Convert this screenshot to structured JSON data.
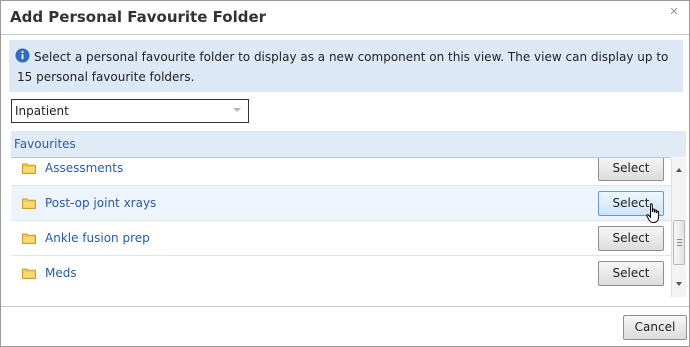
{
  "dialog": {
    "title": "Add Personal Favourite Folder",
    "close_icon": "close-icon"
  },
  "info": {
    "icon": "info-icon",
    "text": "Select a personal favourite folder to display as a new component on this view. The view can display up to 15 personal favourite folders."
  },
  "dropdown": {
    "selected": "Inpatient",
    "icon": "chevron-down-icon"
  },
  "favourites": {
    "header": "Favourites",
    "items": [
      {
        "label": "Assessments",
        "button": "Select",
        "icon": "folder-icon"
      },
      {
        "label": "Post-op joint xrays",
        "button": "Select",
        "icon": "folder-icon"
      },
      {
        "label": "Ankle fusion prep",
        "button": "Select",
        "icon": "folder-icon"
      },
      {
        "label": "Meds",
        "button": "Select",
        "icon": "folder-icon"
      }
    ]
  },
  "footer": {
    "cancel_label": "Cancel"
  },
  "colors": {
    "accent_link": "#2b5aa8",
    "info_background": "#dde8f6",
    "header_background": "#e1ebf6",
    "hover_row": "#eef4fb",
    "folder_yellow": "#f2c94c"
  }
}
